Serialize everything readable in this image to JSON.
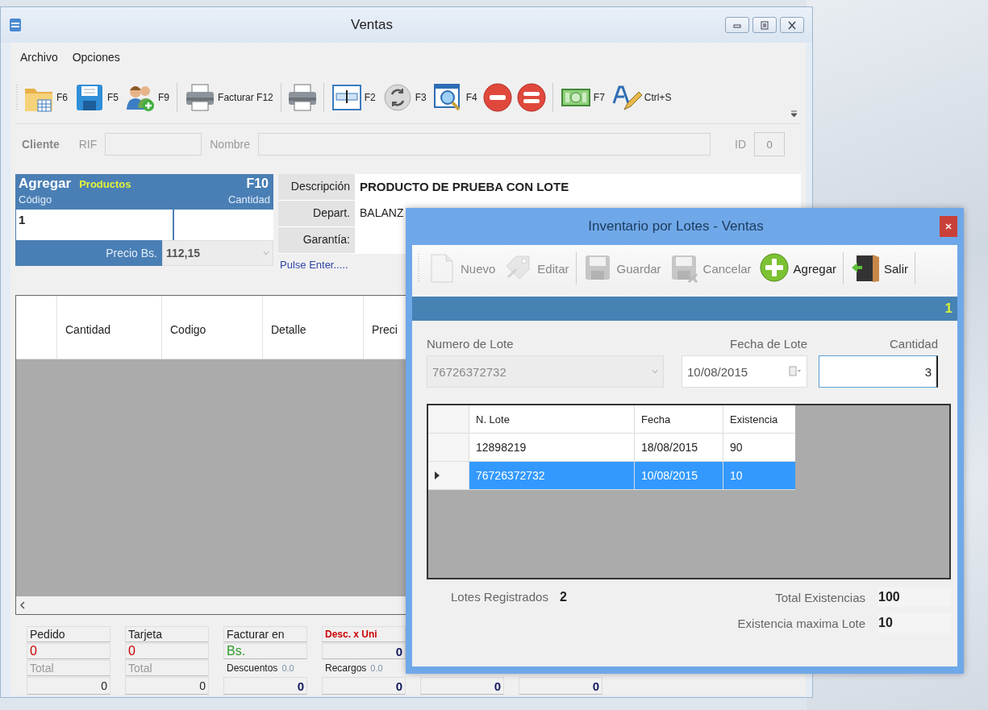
{
  "window": {
    "title": "Ventas"
  },
  "menu": [
    "Archivo",
    "Opciones"
  ],
  "toolbar": [
    {
      "kind": "folder",
      "label": "F6"
    },
    {
      "kind": "save",
      "label": "F5"
    },
    {
      "kind": "users",
      "label": "F9"
    },
    {
      "kind": "separator"
    },
    {
      "kind": "printer",
      "label": "Facturar F12"
    },
    {
      "kind": "separator"
    },
    {
      "kind": "printer"
    },
    {
      "kind": "separator"
    },
    {
      "kind": "form",
      "label": "F2"
    },
    {
      "kind": "refresh",
      "label": "F3"
    },
    {
      "kind": "search-window",
      "label": "F4"
    },
    {
      "kind": "minus"
    },
    {
      "kind": "equals"
    },
    {
      "kind": "separator"
    },
    {
      "kind": "money",
      "label": "F7"
    },
    {
      "kind": "text-edit",
      "label": "Ctrl+S"
    }
  ],
  "cliente": {
    "label": "Cliente",
    "rif_label": "RIF",
    "nombre_label": "Nombre",
    "id_label": "ID",
    "id_value": "0"
  },
  "agregar": {
    "title": "Agregar",
    "subtitle": "Productos",
    "shortcut": "F10",
    "codigo_label": "Código",
    "cantidad_label": "Cantidad",
    "codigo_value": "1",
    "precio_label": "Precio Bs.",
    "precio_value": "112,15"
  },
  "producto": {
    "fields": [
      {
        "label": "Descripción",
        "value": "PRODUCTO DE PRUEBA CON LOTE",
        "kind": "bold"
      },
      {
        "label": "Depart.",
        "value": "BALANZ",
        "kind": "plain"
      },
      {
        "label": "Garantía:",
        "kind": "plain"
      }
    ],
    "hint": "Pulse Enter....."
  },
  "grid": {
    "columns": [
      "Cantidad",
      "Codigo",
      "Detalle",
      "Preci"
    ]
  },
  "totals": [
    {
      "kind": "count",
      "label": "Pedido",
      "value": "0",
      "sub_label": "Total",
      "total": "0"
    },
    {
      "kind": "count",
      "label": "Tarjeta",
      "value": "0",
      "sub_label": "Total",
      "total": "0"
    },
    {
      "kind": "currency",
      "label": "Facturar en",
      "value": "Bs.",
      "sub_label": "Descuentos",
      "sub_value": "0.0",
      "total": "0"
    },
    {
      "kind": "discount",
      "label": "Desc. x Uni",
      "value": "0",
      "sub_label": "Recargos",
      "sub_value": "0.0",
      "total": "0"
    },
    {
      "kind": "amount",
      "total": "0"
    },
    {
      "kind": "amount",
      "total": "0"
    }
  ],
  "dialog": {
    "title": "Inventario por Lotes - Ventas",
    "toolbar": [
      {
        "kind": "new",
        "label": "Nuevo",
        "disabled": true
      },
      {
        "kind": "edit",
        "label": "Editar",
        "disabled": true
      },
      {
        "kind": "separator"
      },
      {
        "kind": "save",
        "label": "Guardar",
        "disabled": true
      },
      {
        "kind": "cancel",
        "label": "Cancelar",
        "disabled": true
      },
      {
        "kind": "add",
        "label": "Agregar",
        "disabled": false
      },
      {
        "kind": "separator"
      },
      {
        "kind": "exit",
        "label": "Salir",
        "disabled": false
      },
      {
        "kind": "separator"
      }
    ],
    "banner": "1",
    "lote_label": "Numero de Lote",
    "lote_value": "76726372732",
    "fecha_label": "Fecha de Lote",
    "fecha_value": "10/08/2015",
    "cantidad_label": "Cantidad",
    "cantidad_value": "3",
    "grid": {
      "columns": [
        "N. Lote",
        "Fecha",
        "Existencia"
      ],
      "rows": [
        {
          "cells": [
            "12898219",
            "18/08/2015",
            "90"
          ],
          "selected": false
        },
        {
          "cells": [
            "76726372732",
            "10/08/2015",
            "10"
          ],
          "selected": true
        }
      ]
    },
    "stats": [
      {
        "label": "Lotes Registrados",
        "value": "2"
      },
      {
        "label": "Total Existencias",
        "value": "100"
      },
      {
        "label": "Existencia maxima Lote",
        "value": "10"
      }
    ]
  }
}
